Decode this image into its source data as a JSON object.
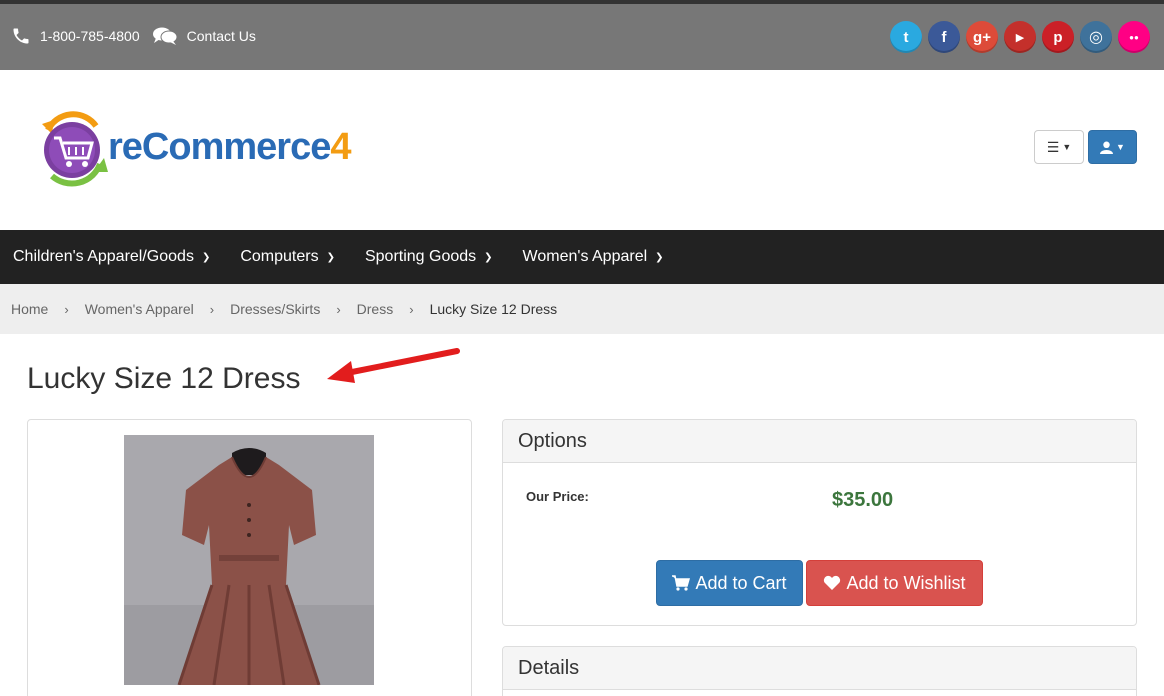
{
  "topbar": {
    "phone": "1-800-785-4800",
    "contact_label": "Contact Us",
    "social": [
      {
        "name": "twitter",
        "color": "#2aa9e0",
        "glyph": "t"
      },
      {
        "name": "facebook",
        "color": "#3b5998",
        "glyph": "f"
      },
      {
        "name": "google-plus",
        "color": "#dd4b39",
        "glyph": "g+"
      },
      {
        "name": "youtube",
        "color": "#c4302b",
        "glyph": "▶"
      },
      {
        "name": "pinterest",
        "color": "#cb2027",
        "glyph": "p"
      },
      {
        "name": "instagram",
        "color": "#3f729b",
        "glyph": "◎"
      },
      {
        "name": "flickr",
        "color": "#ff0084",
        "glyph": "●●"
      }
    ]
  },
  "logo": {
    "prefix": "re",
    "middle": "Commerce",
    "suffix": "4"
  },
  "nav": {
    "items": [
      "Children's Apparel/Goods",
      "Computers",
      "Sporting Goods",
      "Women's Apparel"
    ]
  },
  "breadcrumb": {
    "items": [
      "Home",
      "Women's Apparel",
      "Dresses/Skirts",
      "Dress"
    ],
    "current": "Lucky Size 12 Dress"
  },
  "product": {
    "title": "Lucky Size 12 Dress",
    "options_heading": "Options",
    "price_label": "Our Price:",
    "price": "$35.00",
    "add_to_cart": "Add to Cart",
    "add_to_wishlist": "Add to Wishlist",
    "details_heading": "Details"
  },
  "colors": {
    "primary": "#337ab7",
    "danger": "#d9534f",
    "price": "#3c763d",
    "nav_bg": "#222222",
    "topbar_bg": "#777777"
  }
}
